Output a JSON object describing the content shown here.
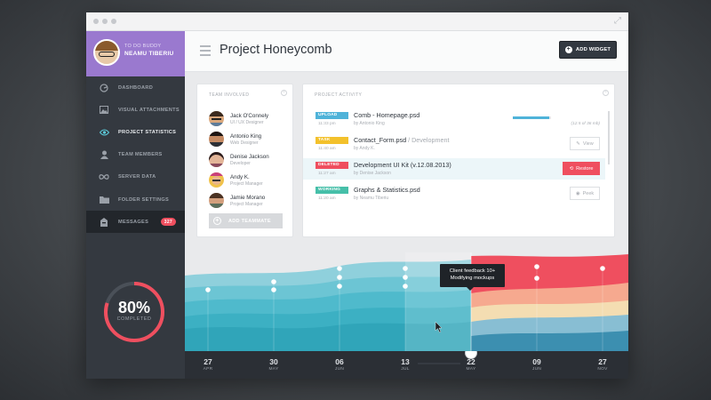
{
  "window": {
    "controls": [
      "close",
      "minimize",
      "maximize"
    ],
    "expand_icon": "expand-icon"
  },
  "profile": {
    "subtitle": "TO DO BUDDY",
    "name": "NEAMU TIBERIU"
  },
  "nav": [
    {
      "label": "DASHBOARD",
      "icon": "speedometer-icon",
      "active": false
    },
    {
      "label": "VISUAL ATTACHMENTS",
      "icon": "image-icon",
      "active": false
    },
    {
      "label": "PROJECT STATISTICS",
      "icon": "eye-icon",
      "active": true
    },
    {
      "label": "TEAM MEMBERS",
      "icon": "user-icon",
      "active": false
    },
    {
      "label": "SERVER DATA",
      "icon": "infinity-icon",
      "active": false
    },
    {
      "label": "FOLDER SETTINGS",
      "icon": "folder-icon",
      "active": false
    },
    {
      "label": "MESSAGES",
      "icon": "inbox-icon",
      "active": false,
      "badge": "327"
    }
  ],
  "completion": {
    "percent_text": "80%",
    "label": "COMPLETED",
    "value": 0.8
  },
  "header": {
    "title": "Project Honeycomb",
    "add_widget": "ADD WIDGET"
  },
  "team": {
    "title": "TEAM INVOLVED",
    "members": [
      {
        "name": "Jack O'Connely",
        "role": "UI / UX Designer"
      },
      {
        "name": "Antonio King",
        "role": "Web Designer"
      },
      {
        "name": "Denise Jackson",
        "role": "Developer"
      },
      {
        "name": "Andy K.",
        "role": "Project Manager"
      },
      {
        "name": "Jamie Morano",
        "role": "Project Manager"
      }
    ],
    "add_button": "ADD TEAMMATE"
  },
  "activity": {
    "title": "PROJECT ACTIVITY",
    "rows": [
      {
        "tag": "UPLOAD",
        "color": "#4fb3d9",
        "time": "11:33 pm",
        "file": "Comb - Homepage.psd",
        "file_sub": "",
        "by": "by Antonio King",
        "progress": 0.95,
        "progress_text": "(12.5 of 36 mb)"
      },
      {
        "tag": "TASK",
        "color": "#f3c12c",
        "time": "11:40 am",
        "file": "Contact_Form.psd",
        "file_sub": "/ Development",
        "by": "by Andy K.",
        "action": "View"
      },
      {
        "tag": "DELETED",
        "color": "#ef4f5f",
        "time": "11:27 am",
        "file": "Development UI Kit (v.12.08.2013)",
        "file_sub": "",
        "by": "by Denise Jackson",
        "action": "Restore"
      },
      {
        "tag": "WORKING",
        "color": "#46bfa9",
        "time": "11:20 am",
        "file": "Graphs & Statistics.psd",
        "file_sub": "",
        "by": "by Neamu Tiberiu",
        "action": "Peek"
      }
    ]
  },
  "timeline": {
    "tooltip_line1": "Client feedback 10+",
    "tooltip_line2": "Modifying mockups",
    "ticks": [
      {
        "day": "27",
        "month": "APR"
      },
      {
        "day": "30",
        "month": "MAY"
      },
      {
        "day": "06",
        "month": "JUN"
      },
      {
        "day": "13",
        "month": "JUL"
      },
      {
        "day": "22",
        "month": "MAY"
      },
      {
        "day": "09",
        "month": "JUN"
      },
      {
        "day": "27",
        "month": "NOV"
      }
    ],
    "colors": {
      "past": "#3cb4c8",
      "future_red": "#ef4f5f",
      "future_peach": "#f6a98f",
      "future_cream": "#f4ddb2",
      "future_blue": "#88bed3",
      "axis": "#2b2f35"
    }
  }
}
